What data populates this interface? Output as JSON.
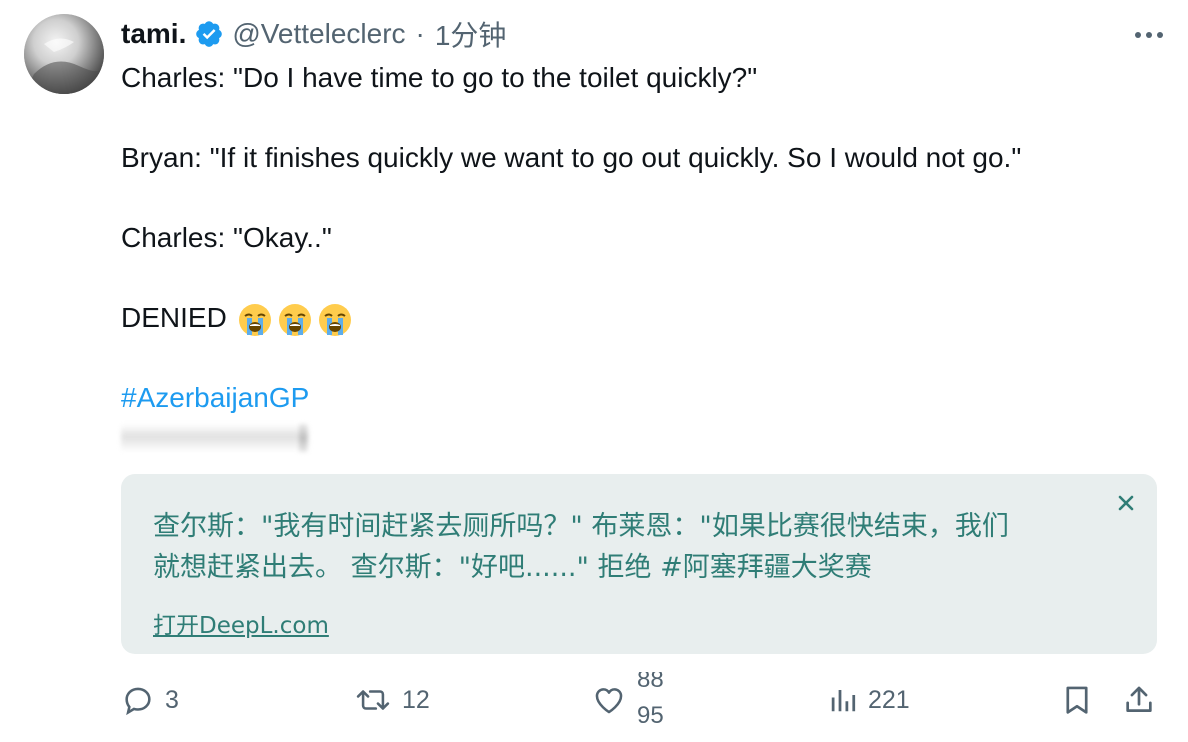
{
  "tweet": {
    "display_name": "tami.",
    "handle": "@Vetteleclerc",
    "separator": "·",
    "time": "1分钟",
    "verified": true,
    "lines": [
      "Charles: \"Do I have time to go to the toilet quickly?\"",
      "Bryan: \"If it finishes quickly we want to go out quickly. So I would not go.\"",
      "Charles: \"Okay..\"",
      "DENIED"
    ],
    "emoji": "loudly-crying-face",
    "emoji_count": 3,
    "hashtag": "#AzerbaijanGP"
  },
  "translation": {
    "line1": "查尔斯：\"我有时间赶紧去厕所吗？\" 布莱恩：\"如果比赛很快结束，我们",
    "line2": "就想赶紧出去。 查尔斯：\"好吧......\" 拒绝 #阿塞拜疆大奖赛",
    "link": "打开DeepL.com"
  },
  "actions": {
    "reply": "3",
    "retweet": "12",
    "like_top": "88",
    "like_bottom": "95",
    "views": "221"
  },
  "colors": {
    "text": "#0f1419",
    "secondary": "#536471",
    "link": "#1d9bf0",
    "verified": "#1d9bf0",
    "translation_bg": "#e8eeee",
    "translation_text": "#2f7d76"
  }
}
